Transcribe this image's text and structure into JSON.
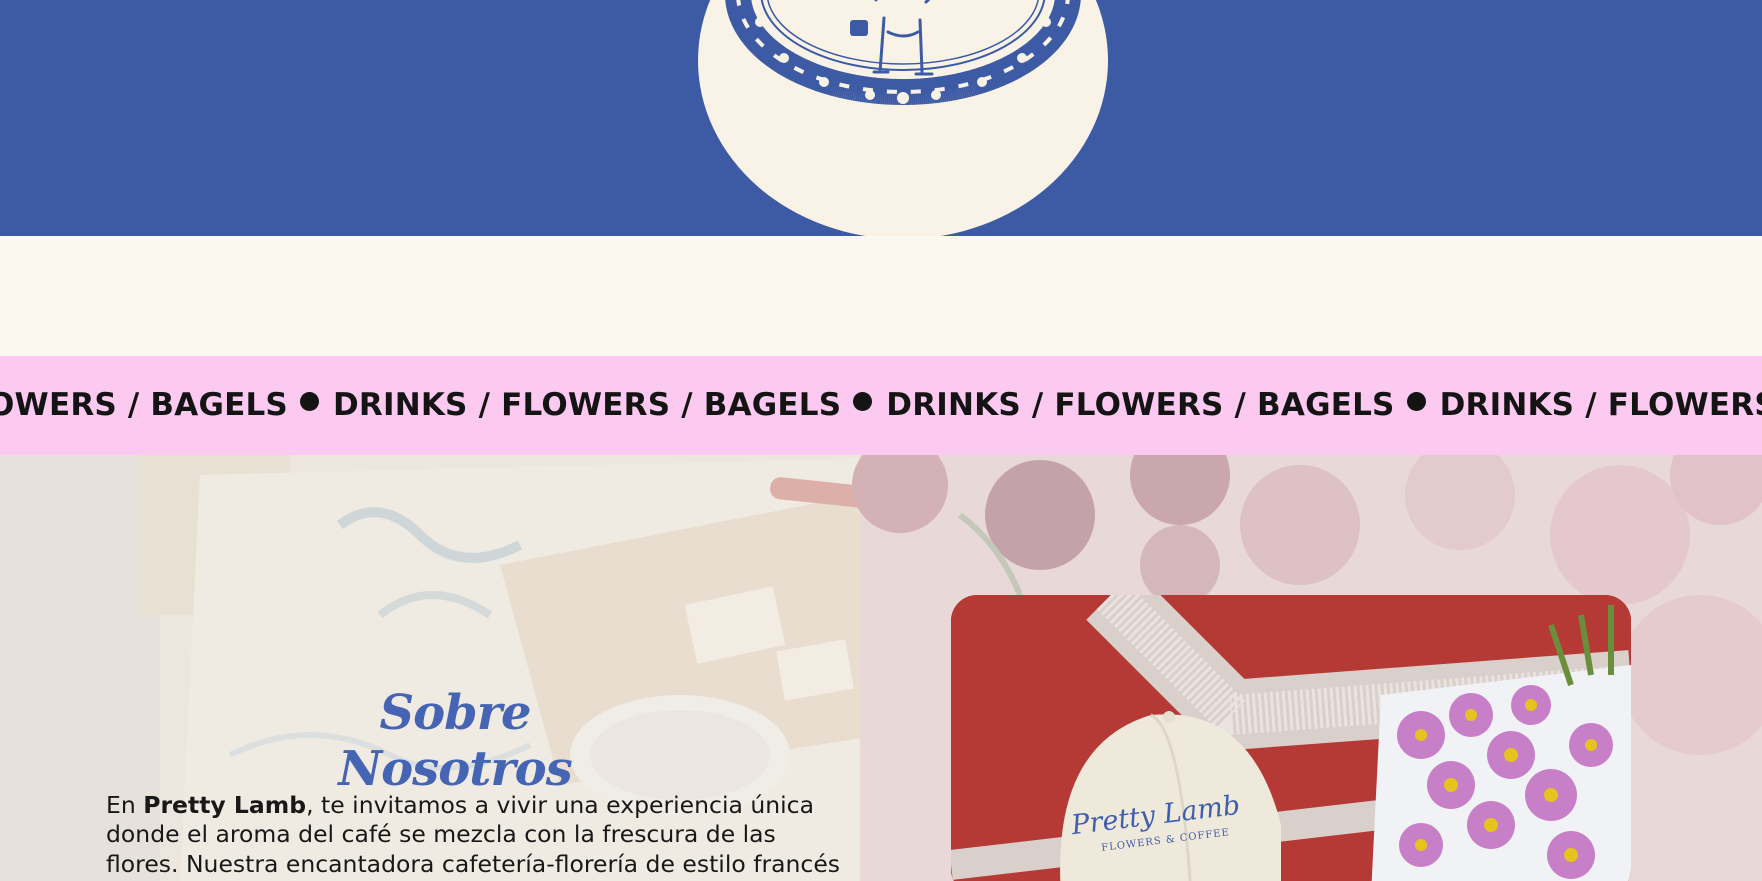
{
  "header": {
    "logo_icon": "pretty-lamb-badge-logo",
    "brand_color": "#3d5ba4",
    "badge_color": "#f8f3e6"
  },
  "marquee": {
    "background": "#fccaf0",
    "leading_fragment": "OWERS / BAGELS",
    "items": [
      "DRINKS / FLOWERS / BAGELS",
      "DRINKS / FLOWERS / BAGELS",
      "DRINKS / FLOWERS /"
    ],
    "separator_icon": "bullet-dot-icon"
  },
  "about": {
    "title": "Sobre Nosotros",
    "text_prefix": "En ",
    "brand_name": "Pretty Lamb",
    "text_body": ", te invitamos a vivir una experiencia única donde el aroma del café se mezcla con la frescura de las flores. Nuestra encantadora cafetería-florería de estilo francés combina lo natural con lo acogedor. Cada rincón está",
    "photo_cap_text": "Pretty Lamb",
    "photo_cap_subtext": "FLOWERS & COFFEE"
  }
}
